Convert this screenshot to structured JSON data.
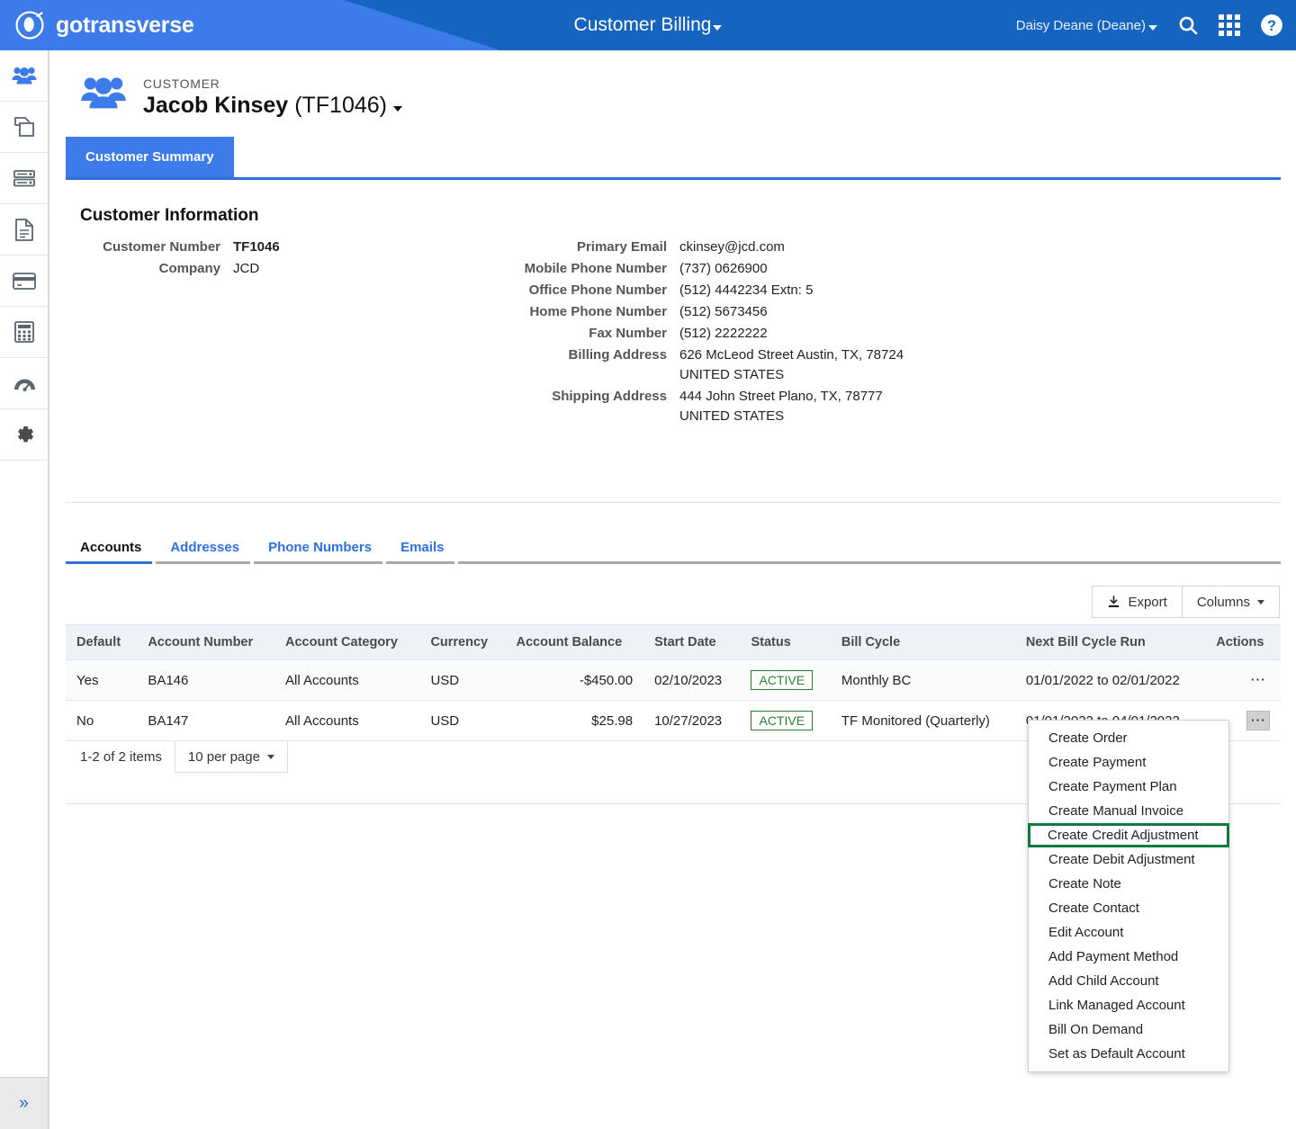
{
  "header": {
    "brand": "gotransverse",
    "brand_logo_icon": "gotransverse-logo-icon",
    "app_title": "Customer Billing",
    "app_title_caret_icon": "chevron-down-icon",
    "user": "Daisy Deane (Deane)",
    "user_caret_icon": "chevron-down-icon",
    "search_icon": "search-icon",
    "apps_icon": "grid-apps-icon",
    "help_icon": "help-circle-icon",
    "bg_color": "#1565c0",
    "accent_color": "#3d7beb"
  },
  "sidebar": {
    "items": [
      {
        "name": "customers",
        "icon": "people-group-icon",
        "active": true
      },
      {
        "name": "products",
        "icon": "copy-pages-icon",
        "active": false
      },
      {
        "name": "servers",
        "icon": "database-stack-icon",
        "active": false
      },
      {
        "name": "invoices",
        "icon": "document-icon",
        "active": false
      },
      {
        "name": "payments",
        "icon": "credit-card-icon",
        "active": false
      },
      {
        "name": "billing",
        "icon": "calculator-icon",
        "active": false
      },
      {
        "name": "dashboard",
        "icon": "gauge-icon",
        "active": false
      },
      {
        "name": "settings",
        "icon": "gear-icon",
        "active": false
      }
    ],
    "expand_icon": "double-chevron-right-icon"
  },
  "customer": {
    "kicker": "CUSTOMER",
    "name": "Jacob Kinsey",
    "number_paren": "(TF1046)",
    "caret_icon": "chevron-down-icon",
    "avatar_icon": "people-group-icon",
    "page_tab": "Customer Summary"
  },
  "customer_information": {
    "section_title": "Customer Information",
    "left": [
      {
        "label": "Customer Number",
        "value": "TF1046",
        "bold": true
      },
      {
        "label": "Company",
        "value": "JCD",
        "bold": false
      }
    ],
    "right": [
      {
        "label": "Primary Email",
        "value": "ckinsey@jcd.com"
      },
      {
        "label": "Mobile Phone Number",
        "value": "(737) 0626900"
      },
      {
        "label": "Office Phone Number",
        "value": "(512) 4442234 Extn: 5"
      },
      {
        "label": "Home Phone Number",
        "value": "(512) 5673456"
      },
      {
        "label": "Fax Number",
        "value": "(512) 2222222"
      },
      {
        "label": "Billing Address",
        "value": "626 McLeod Street Austin, TX, 78724 UNITED STATES"
      },
      {
        "label": "Shipping Address",
        "value": "444 John Street Plano, TX, 78777 UNITED STATES"
      }
    ]
  },
  "subtabs": [
    {
      "label": "Accounts",
      "active": true
    },
    {
      "label": "Addresses",
      "active": false
    },
    {
      "label": "Phone Numbers",
      "active": false
    },
    {
      "label": "Emails",
      "active": false
    }
  ],
  "toolbar": {
    "export_label": "Export",
    "export_icon": "download-icon",
    "columns_label": "Columns",
    "columns_caret_icon": "chevron-down-icon"
  },
  "table": {
    "columns": [
      "Default",
      "Account Number",
      "Account Category",
      "Currency",
      "Account Balance",
      "Start Date",
      "Status",
      "Bill Cycle",
      "Next Bill Cycle Run",
      "Actions"
    ],
    "rows": [
      {
        "default": "Yes",
        "account_number": "BA146",
        "account_category": "All Accounts",
        "currency": "USD",
        "account_balance": "-$450.00",
        "start_date": "02/10/2023",
        "status": "ACTIVE",
        "bill_cycle": "Monthly BC",
        "next_bill_cycle_run": "01/01/2022 to 02/01/2022",
        "actions_icon": "kebab-menu-icon",
        "actions_pressed": false
      },
      {
        "default": "No",
        "account_number": "BA147",
        "account_category": "All Accounts",
        "currency": "USD",
        "account_balance": "$25.98",
        "start_date": "10/27/2023",
        "status": "ACTIVE",
        "bill_cycle": "TF Monitored (Quarterly)",
        "next_bill_cycle_run": "01/01/2022 to 04/01/2022",
        "actions_icon": "kebab-menu-icon",
        "actions_pressed": true
      }
    ],
    "status_color": "#2e7d32"
  },
  "pagination": {
    "count_text": "1-2 of 2 items",
    "page_size_label": "10 per page",
    "page_size_caret_icon": "chevron-down-icon"
  },
  "actions_menu": {
    "highlight_color": "#0f7a3d",
    "items": [
      {
        "label": "Create Order",
        "highlighted": false
      },
      {
        "label": "Create Payment",
        "highlighted": false
      },
      {
        "label": "Create Payment Plan",
        "highlighted": false
      },
      {
        "label": "Create Manual Invoice",
        "highlighted": false
      },
      {
        "label": "Create Credit Adjustment",
        "highlighted": true
      },
      {
        "label": "Create Debit Adjustment",
        "highlighted": false
      },
      {
        "label": "Create Note",
        "highlighted": false
      },
      {
        "label": "Create Contact",
        "highlighted": false
      },
      {
        "label": "Edit Account",
        "highlighted": false
      },
      {
        "label": "Add Payment Method",
        "highlighted": false
      },
      {
        "label": "Add Child Account",
        "highlighted": false
      },
      {
        "label": "Link Managed Account",
        "highlighted": false
      },
      {
        "label": "Bill On Demand",
        "highlighted": false
      },
      {
        "label": "Set as Default Account",
        "highlighted": false
      }
    ]
  }
}
